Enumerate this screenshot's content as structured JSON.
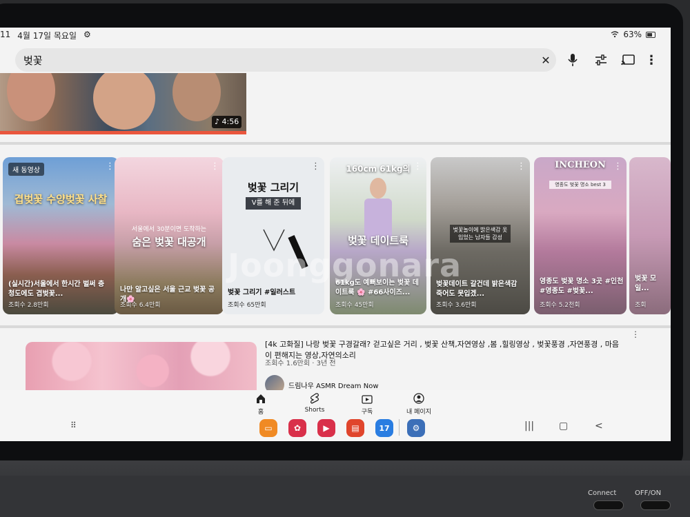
{
  "status_bar": {
    "time_fragment": "11",
    "date": "4월 17일 목요일",
    "battery": "63%"
  },
  "search": {
    "query": "벚꽃"
  },
  "top_video": {
    "duration": "4:56"
  },
  "shorts": [
    {
      "badge": "새 동영상",
      "headline": "겹벚꽃 수양벚꽃 사찰",
      "title": "(실시간)서울에서 한시간 벌써 충청도에도 겹벚꽃...",
      "views": "조회수 2.8만회"
    },
    {
      "headline": "숨은 벚꽃 대공개",
      "subheadline": "서울에서 30분이면 도착하는",
      "title": "나만 알고싶은 서울 근교 벚꽃 공개🌸",
      "views": "조회수 6.4만회"
    },
    {
      "headline": "벚꽃 그리기",
      "subheadline": "V를 해 준 뒤에",
      "title": "벚꽃 그리기 #일러스트",
      "views": "조회수 65만회"
    },
    {
      "headline": "160cm 61kg의",
      "subheadline": "벚꽃 데이트룩",
      "title": "61kg도 예뻐보이는 벚꽃 데이트룩 🌸 #66사이즈...",
      "views": "조회수 45만회"
    },
    {
      "headline": "벚꽃놀이에 밝은색감 옷 입었는 남자들 감성",
      "title": "벚꽃데이트 갈건데 밝은색감 죽어도 못입겠...",
      "views": "조회수 3.6만회"
    },
    {
      "headline": "INCHEON",
      "subheadline": "영종도 벚꽃 명소 best 3",
      "title": "영종도 벚꽃 명소 3곳 #인천 #영종도 #벚꽃...",
      "views": "조회수 5.2천회"
    },
    {
      "title": "벚꽃 모일...",
      "views": "조회"
    }
  ],
  "video": {
    "title": "[4k 고화질] 나랑 벚꽃 구경갈래? 걷고싶은 거리 , 벚꽃 산책,자연영상 ,봄 ,힐링영상 , 벚꽃풍경 ,자연풍경 , 마음이 편해지는 영상,자연의소리",
    "meta": "조회수 1.6만회 · 3년 전",
    "channel": "드림나우 ASMR Dream Now"
  },
  "bottom_nav": {
    "home": "홈",
    "shorts": "Shorts",
    "subscriptions": "구독",
    "my_page": "내 페이지"
  },
  "dock": {
    "calendar_date": "17"
  },
  "watermark": "Joonggonara",
  "hardware": {
    "connect": "Connect",
    "power": "OFF/ON"
  },
  "colors": {
    "accent_red": "#e9563d",
    "screen_bg": "#f3f3f3"
  }
}
